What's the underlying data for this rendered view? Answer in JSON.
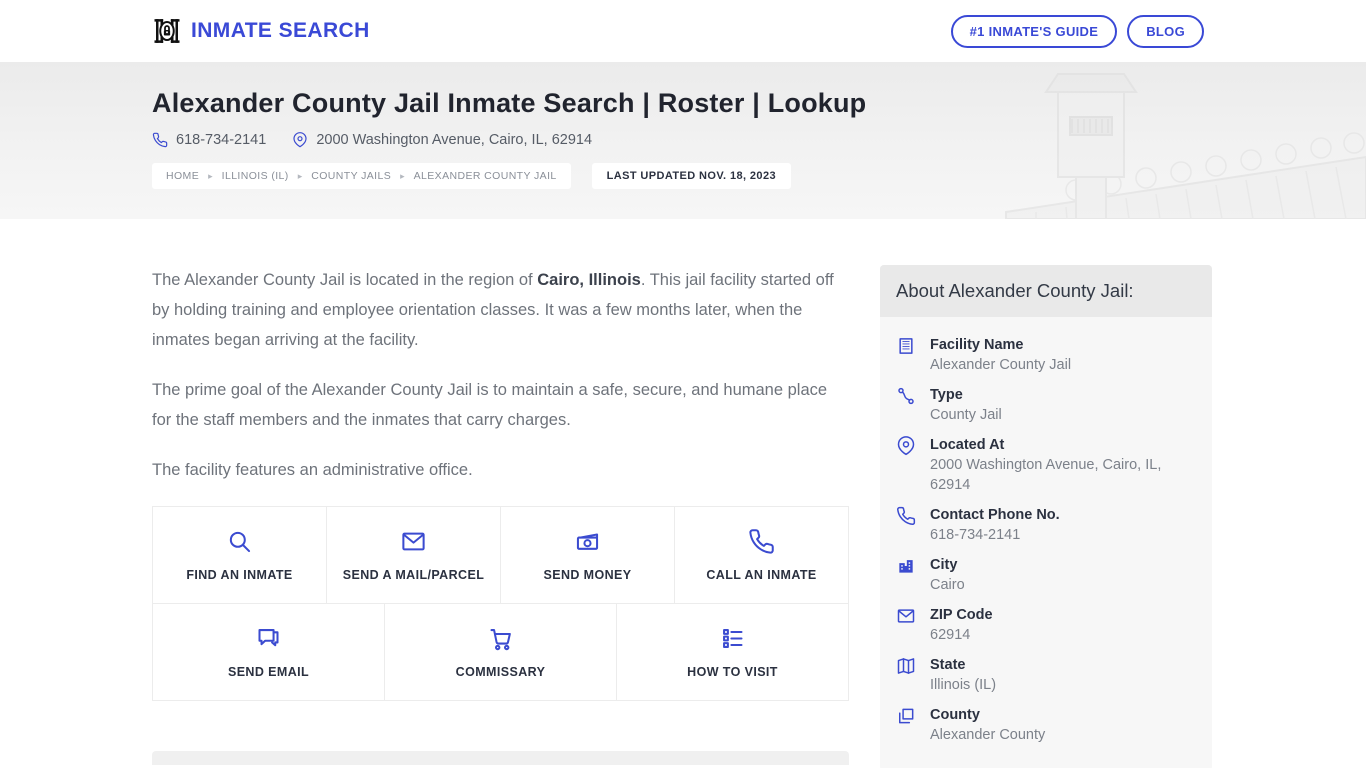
{
  "colors": {
    "accent": "#3a49d6",
    "title": "#21242e",
    "body_text": "#6e737b"
  },
  "header": {
    "brand": "INMATE SEARCH",
    "guide_button": "#1 INMATE'S GUIDE",
    "blog_button": "BLOG"
  },
  "hero": {
    "title": "Alexander County Jail Inmate Search | Roster | Lookup",
    "phone": "618-734-2141",
    "address": "2000 Washington Avenue, Cairo, IL, 62914",
    "breadcrumb": {
      "0": "HOME",
      "1": "ILLINOIS (IL)",
      "2": "COUNTY JAILS",
      "3": "ALEXANDER COUNTY JAIL"
    },
    "separator": "▸",
    "last_updated": "LAST UPDATED NOV. 18, 2023"
  },
  "article": {
    "p1_before": "The Alexander County Jail is located in the region of ",
    "p1_bold": "Cairo, Illinois",
    "p1_after": ". This jail facility started off by holding training and employee orientation classes. It was a few months later, when the inmates began arriving at the facility.",
    "p2": "The prime goal of the Alexander County Jail is to maintain a safe, secure, and humane place for the staff members and the inmates that carry charges.",
    "p3": "The facility features an administrative office."
  },
  "services": {
    "row1": {
      "0": {
        "label": "FIND AN INMATE",
        "icon": "search-icon"
      },
      "1": {
        "label": "SEND A MAIL/PARCEL",
        "icon": "mail-icon"
      },
      "2": {
        "label": "SEND MONEY",
        "icon": "banknote-icon"
      },
      "3": {
        "label": "CALL AN INMATE",
        "icon": "phone-icon"
      }
    },
    "row2": {
      "0": {
        "label": "SEND EMAIL",
        "icon": "chat-bubbles-icon"
      },
      "1": {
        "label": "COMMISSARY",
        "icon": "cart-icon"
      },
      "2": {
        "label": "HOW TO VISIT",
        "icon": "checklist-icon"
      }
    }
  },
  "sidebar": {
    "title": "About Alexander County Jail:",
    "items": {
      "0": {
        "label": "Facility Name",
        "value": "Alexander County Jail",
        "icon": "building-icon"
      },
      "1": {
        "label": "Type",
        "value": "County Jail",
        "icon": "route-icon"
      },
      "2": {
        "label": "Located At",
        "value": "2000 Washington Avenue, Cairo, IL, 62914",
        "icon": "map-pin-icon"
      },
      "3": {
        "label": "Contact Phone No.",
        "value": "618-734-2141",
        "icon": "phone-icon"
      },
      "4": {
        "label": "City",
        "value": "Cairo",
        "icon": "city-icon"
      },
      "5": {
        "label": "ZIP Code",
        "value": "62914",
        "icon": "envelope-icon"
      },
      "6": {
        "label": "State",
        "value": "Illinois (IL)",
        "icon": "map-icon"
      },
      "7": {
        "label": "County",
        "value": "Alexander County",
        "icon": "copy-icon"
      }
    }
  }
}
